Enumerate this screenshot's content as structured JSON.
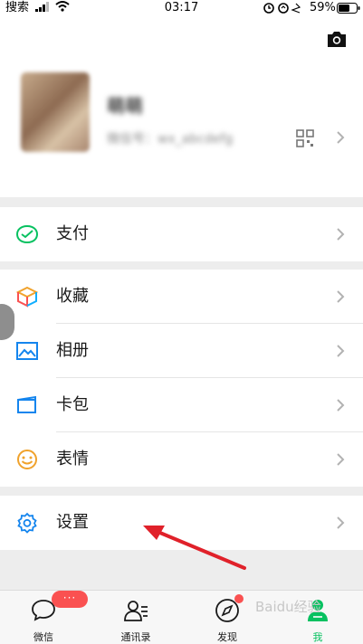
{
  "status_bar": {
    "carrier": "搜索",
    "time": "03:17",
    "battery": "59%"
  },
  "profile": {
    "nickname": "萌萌",
    "wechat_id": "微信号：wx_abcdefg"
  },
  "menu_groups": {
    "pay": {
      "label": "支付"
    },
    "favorites": {
      "label": "收藏"
    },
    "album": {
      "label": "相册"
    },
    "cards": {
      "label": "卡包"
    },
    "stickers": {
      "label": "表情"
    },
    "settings": {
      "label": "设置"
    }
  },
  "tabbar": {
    "chats": {
      "label": "微信",
      "badge": "···"
    },
    "contacts": {
      "label": "通讯录"
    },
    "discover": {
      "label": "发现"
    },
    "me": {
      "label": "我"
    }
  },
  "watermark": "Baidu经验",
  "colors": {
    "accent": "#07c160",
    "badge": "#fa5151",
    "arrow": "#e0212a"
  }
}
